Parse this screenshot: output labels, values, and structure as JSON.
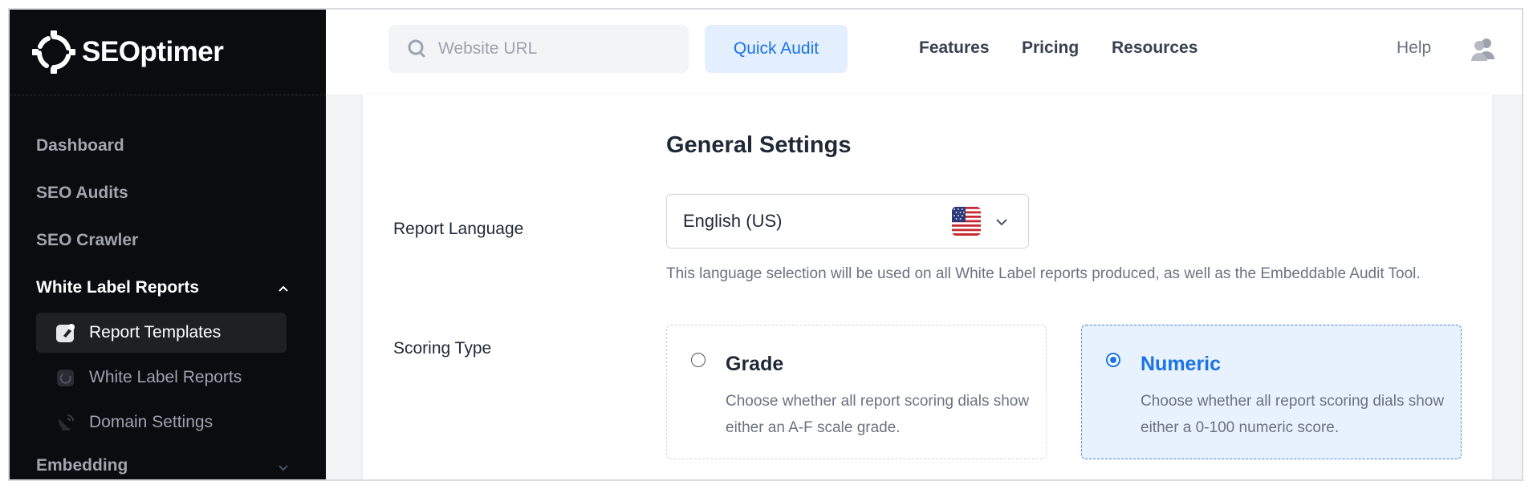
{
  "brand": {
    "name": "SEOptimer",
    "accent": "#1a73e8",
    "sidebar_bg": "#0b0c10"
  },
  "sidebar": {
    "items": [
      {
        "label": "Dashboard"
      },
      {
        "label": "SEO Audits"
      },
      {
        "label": "SEO Crawler"
      },
      {
        "label": "White Label Reports",
        "expanded": true,
        "chevron": "chevron-up-icon"
      },
      {
        "label": "Embedding",
        "expanded": false,
        "chevron": "chevron-down-icon"
      }
    ],
    "sub_items": [
      {
        "label": "Report Templates",
        "icon": "report-template-icon",
        "active": true
      },
      {
        "label": "White Label Reports",
        "icon": "white-label-icon",
        "active": false
      },
      {
        "label": "Domain Settings",
        "icon": "satellite-dish-icon",
        "active": false
      }
    ]
  },
  "topbar": {
    "search_placeholder": "Website URL",
    "quick_audit_label": "Quick Audit",
    "links": [
      "Features",
      "Pricing",
      "Resources"
    ],
    "help_label": "Help"
  },
  "settings": {
    "title": "General Settings",
    "report_language": {
      "label": "Report Language",
      "value": "English (US)",
      "flag": "us-flag-icon",
      "help": "This language selection will be used on all White Label reports produced, as well as the Embeddable Audit Tool."
    },
    "scoring_type": {
      "label": "Scoring Type",
      "selected": "Numeric",
      "options": [
        {
          "title": "Grade",
          "description": "Choose whether all report scoring dials show either an A-F scale grade."
        },
        {
          "title": "Numeric",
          "description": "Choose whether all report scoring dials show either a 0-100 numeric score."
        }
      ]
    }
  }
}
